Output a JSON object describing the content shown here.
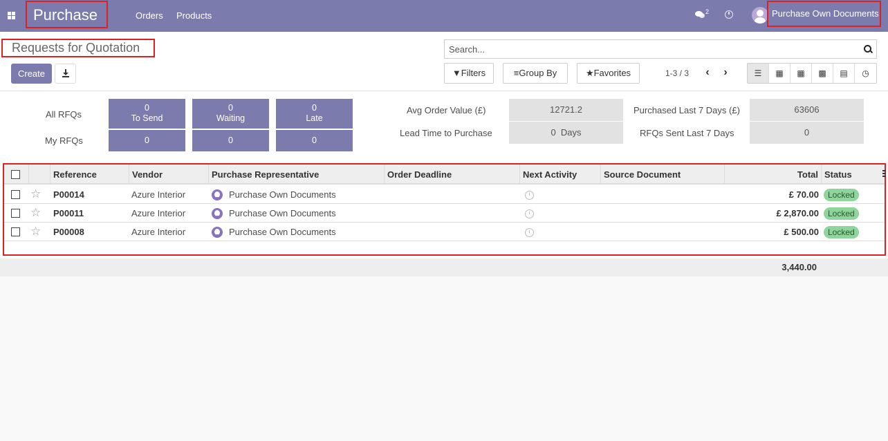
{
  "nav": {
    "brand": "Purchase",
    "menu": [
      "Orders",
      "Products"
    ],
    "chat_count": "2",
    "user_name": "Purchase Own Documents"
  },
  "control": {
    "breadcrumb": "Requests for Quotation",
    "create_label": "Create",
    "search_placeholder": "Search...",
    "filters_label": "Filters",
    "groupby_label": "Group By",
    "favorites_label": "Favorites",
    "pager": "1-3 / 3"
  },
  "dashboard": {
    "all_rfqs_label": "All RFQs",
    "my_rfqs_label": "My RFQs",
    "tiles": [
      {
        "label": "To Send",
        "all": "0",
        "my": "0"
      },
      {
        "label": "Waiting",
        "all": "0",
        "my": "0"
      },
      {
        "label": "Late",
        "all": "0",
        "my": "0"
      }
    ],
    "avg_order_label": "Avg Order Value (£)",
    "avg_order_value": "12721.2",
    "lead_time_label": "Lead Time to Purchase",
    "lead_time_value": "0  Days",
    "purchased_label": "Purchased Last 7 Days (£)",
    "purchased_value": "63606",
    "rfqs_sent_label": "RFQs Sent Last 7 Days",
    "rfqs_sent_value": "0"
  },
  "table": {
    "columns": [
      "Reference",
      "Vendor",
      "Purchase Representative",
      "Order Deadline",
      "Next Activity",
      "Source Document",
      "Total",
      "Status"
    ],
    "rows": [
      {
        "reference": "P00014",
        "vendor": "Azure Interior",
        "rep": "Purchase Own Documents",
        "total": "£ 70.00",
        "status": "Locked"
      },
      {
        "reference": "P00011",
        "vendor": "Azure Interior",
        "rep": "Purchase Own Documents",
        "total": "£ 2,870.00",
        "status": "Locked"
      },
      {
        "reference": "P00008",
        "vendor": "Azure Interior",
        "rep": "Purchase Own Documents",
        "total": "£ 500.00",
        "status": "Locked"
      }
    ],
    "sum_total": "3,440.00"
  }
}
